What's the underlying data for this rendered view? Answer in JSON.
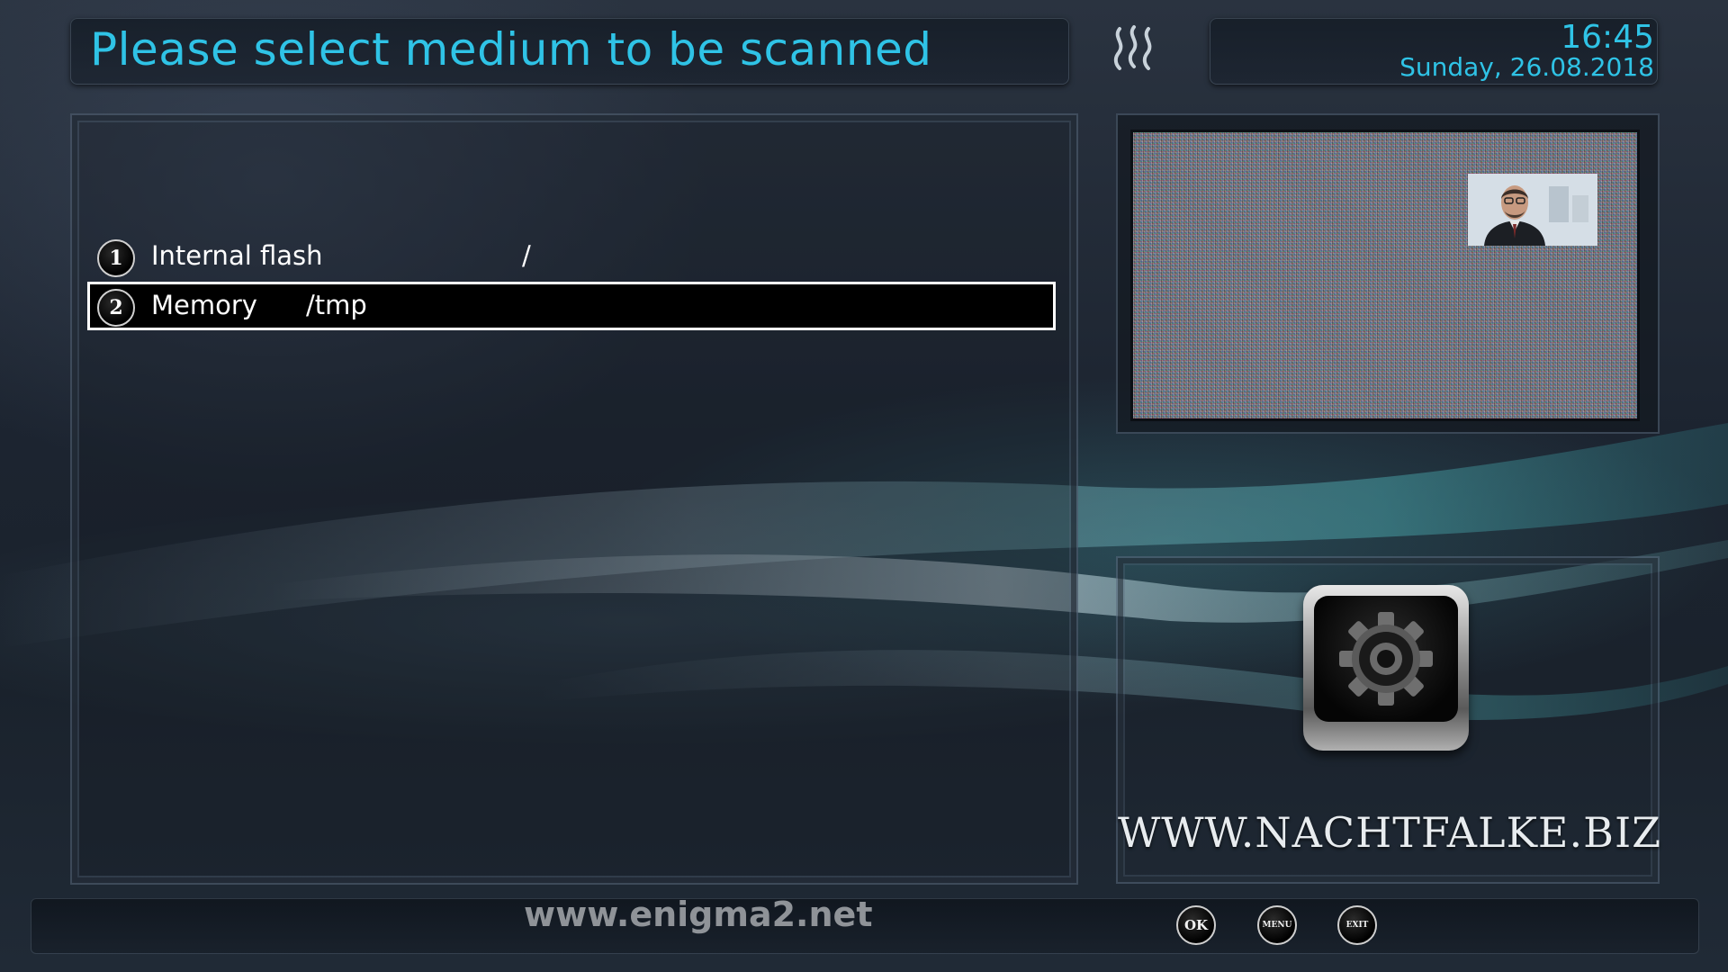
{
  "header": {
    "title": "Please select medium to be scanned",
    "time": "16:45",
    "date": "Sunday, 26.08.2018"
  },
  "media_list": {
    "items": [
      {
        "number": "1",
        "name": "Internal flash",
        "path": "/",
        "selected": false
      },
      {
        "number": "2",
        "name": "Memory",
        "path": "/tmp",
        "selected": true
      }
    ]
  },
  "branding": {
    "site": "WWW.NACHTFALKE.BIZ",
    "watermark": "www.enigma2.net"
  },
  "buttons": {
    "ok": "OK",
    "menu": "MENU",
    "exit": "EXIT"
  },
  "icons": {
    "header_logo": "wave-logo-icon",
    "settings": "gear-icon",
    "preview": "tv-preview"
  },
  "colors": {
    "accent": "#2fc3e6",
    "selection_bg": "#000000",
    "selection_border": "#ffffff"
  }
}
